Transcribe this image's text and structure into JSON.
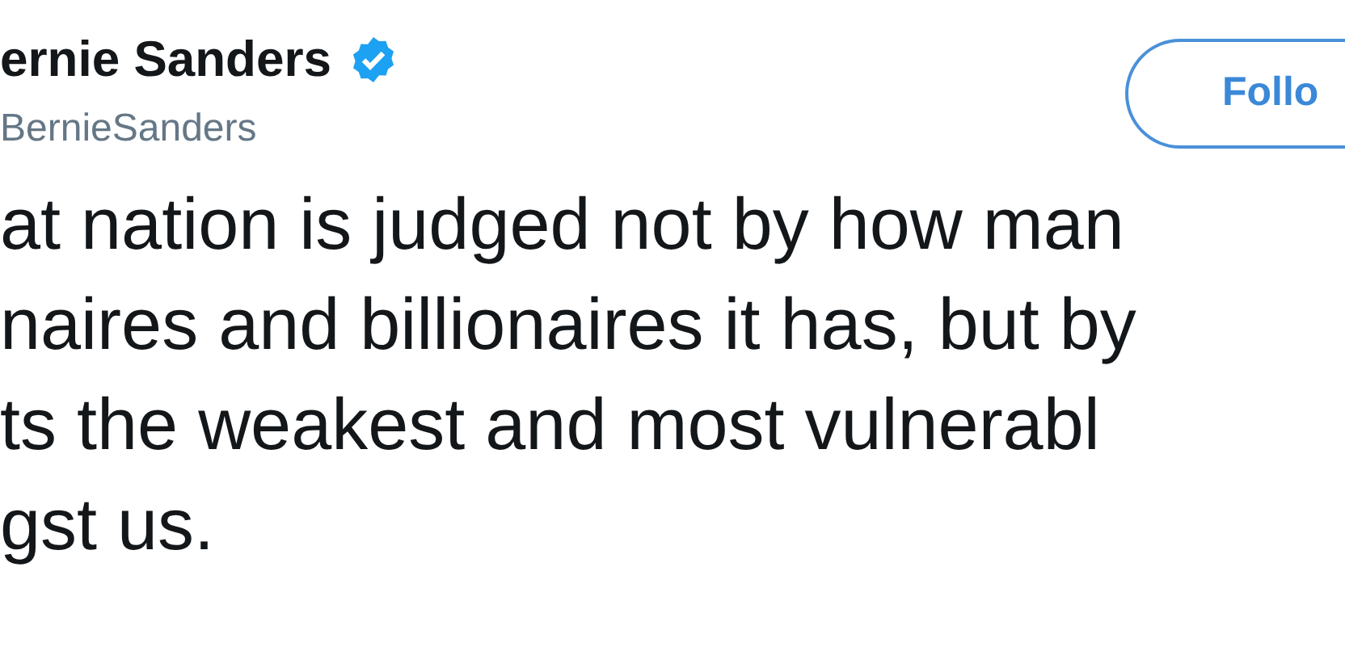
{
  "author": {
    "name": "ernie Sanders",
    "verified": true,
    "handle": "BernieSanders"
  },
  "follow_button": {
    "label": "Follo"
  },
  "tweet_lines": [
    "at nation is judged not by how man",
    "naires and billionaires it has, but by",
    "ts the weakest and most vulnerabl",
    "gst us."
  ]
}
